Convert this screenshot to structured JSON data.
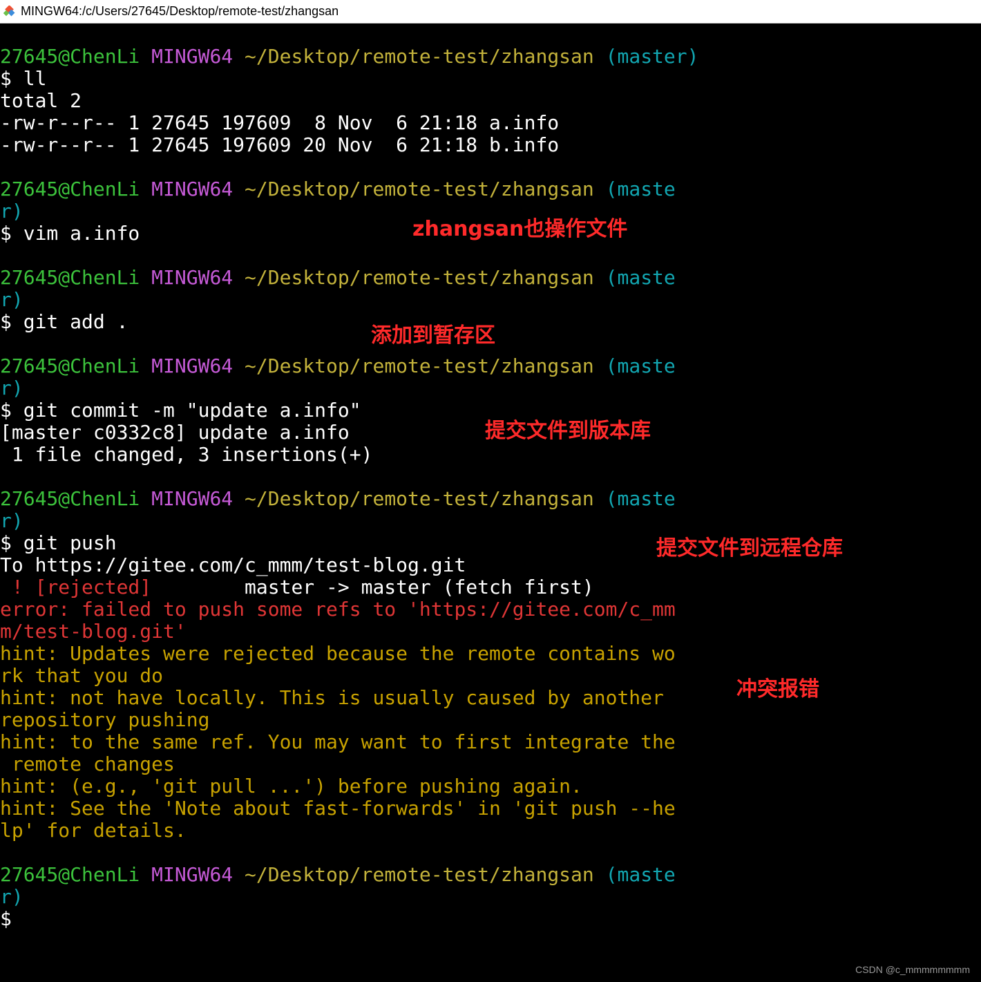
{
  "window": {
    "title": "MINGW64:/c/Users/27645/Desktop/remote-test/zhangsan",
    "icon": "git-bash-icon"
  },
  "colors": {
    "user_host": "#3cc23c",
    "system": "#c55ad6",
    "path": "#c3b23b",
    "branch": "#12a6b1",
    "error": "#e03636",
    "hint": "#c8a200",
    "annotation": "#ff2a2a"
  },
  "prompt": {
    "user_host": "27645@ChenLi",
    "system": "MINGW64",
    "path": "~/Desktop/remote-test/zhangsan",
    "branch_full": "(master)",
    "branch_wrap_a": "(maste",
    "branch_wrap_b": "r)",
    "symbol": "$"
  },
  "commands": {
    "ll": "$ ll",
    "vim": "$ vim a.info",
    "add": "$ git add .",
    "commit": "$ git commit -m \"update a.info\"",
    "push": "$ git push"
  },
  "output": {
    "ll": [
      "total 2",
      "-rw-r--r-- 1 27645 197609  8 Nov  6 21:18 a.info",
      "-rw-r--r-- 1 27645 197609 20 Nov  6 21:18 b.info"
    ],
    "commit": [
      "[master c0332c8] update a.info",
      " 1 file changed, 3 insertions(+)"
    ],
    "push_to": "To https://gitee.com/c_mmm/test-blog.git",
    "push_rejected_mark": " ! [rejected]",
    "push_rejected_rest": "        master -> master (fetch first)",
    "push_error": [
      "error: failed to push some refs to 'https://gitee.com/c_mm",
      "m/test-blog.git'"
    ],
    "push_hints": [
      "hint: Updates were rejected because the remote contains wo",
      "rk that you do",
      "hint: not have locally. This is usually caused by another",
      "repository pushing",
      "hint: to the same ref. You may want to first integrate the",
      " remote changes",
      "hint: (e.g., 'git pull ...') before pushing again.",
      "hint: See the 'Note about fast-forwards' in 'git push --he",
      "lp' for details."
    ]
  },
  "annotations": {
    "vim": "zhangsan也操作文件",
    "add": "添加到暂存区",
    "commit": "提交文件到版本库",
    "push": "提交文件到远程仓库",
    "conflict": "冲突报错"
  },
  "watermark": "CSDN @c_mmmmmmmm"
}
